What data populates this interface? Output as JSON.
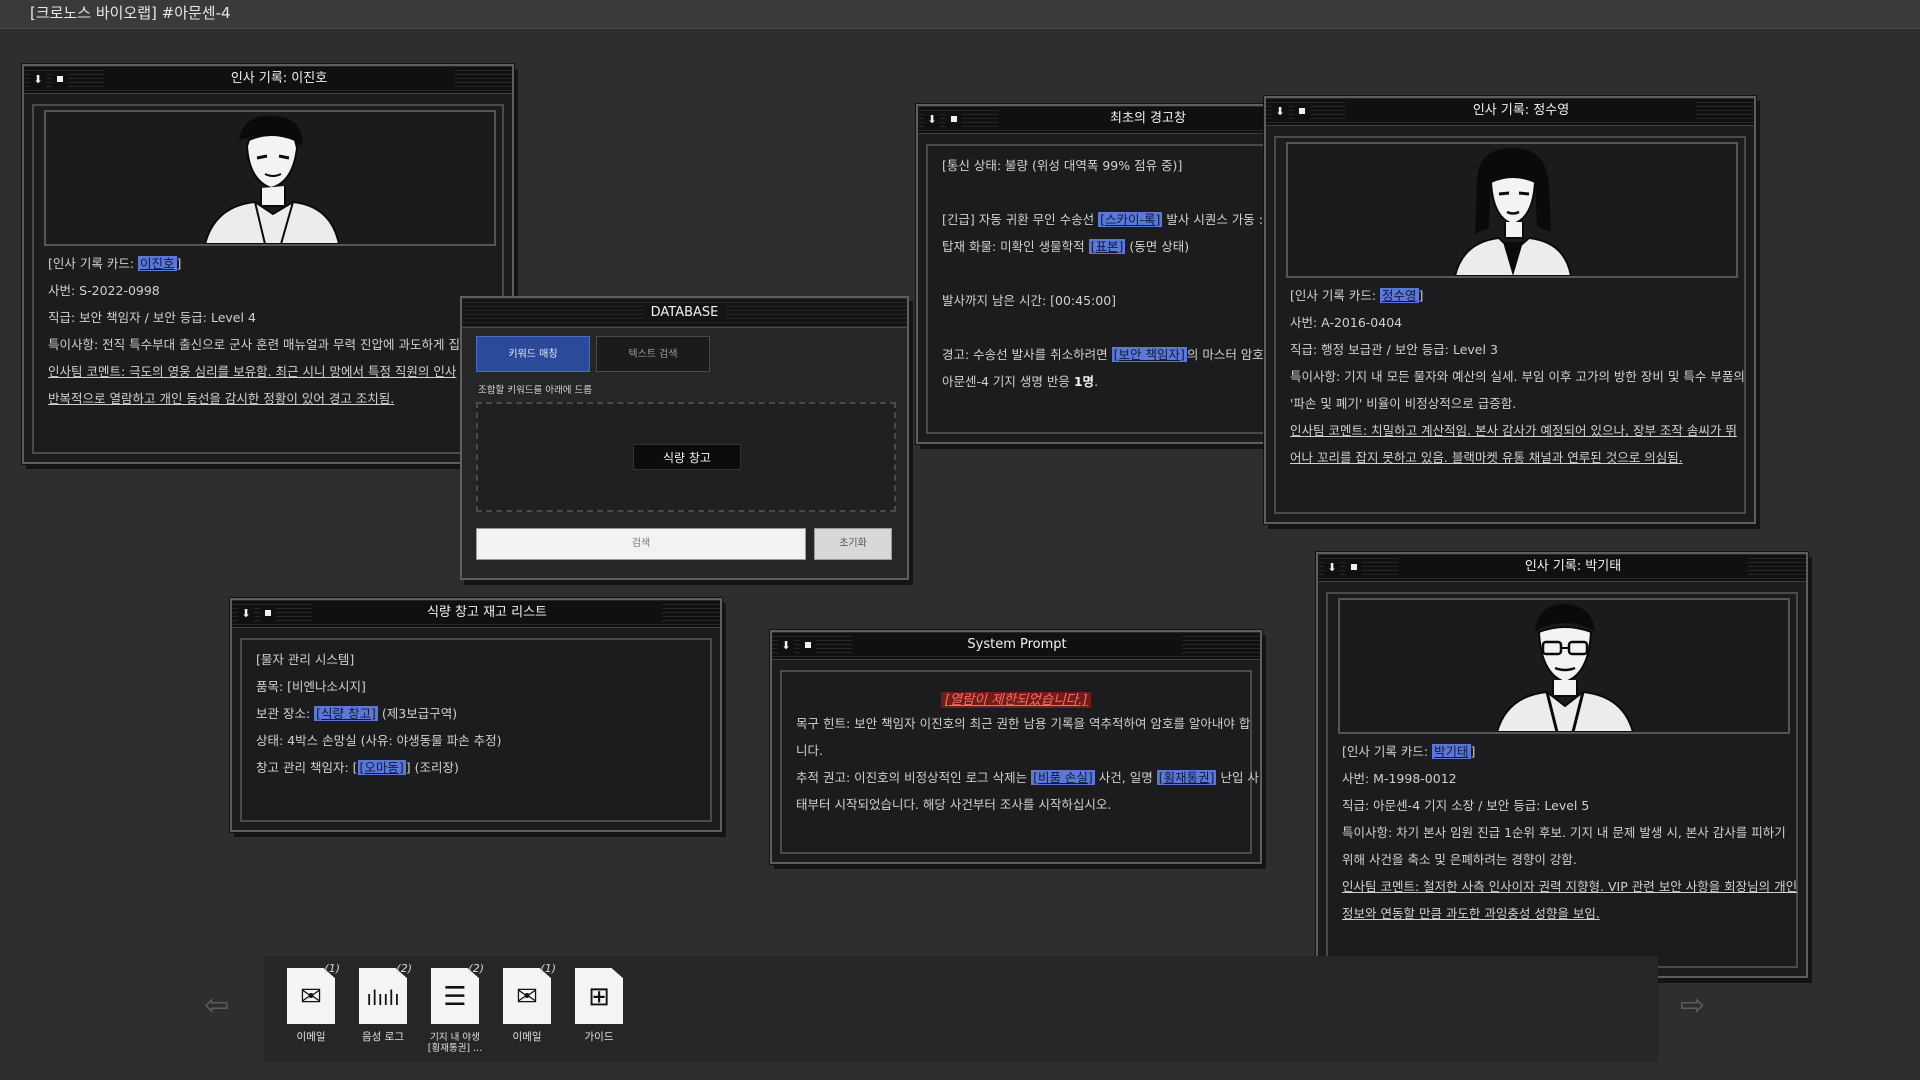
{
  "app": {
    "title": "[크로노스 바이오랩] #아문센-4"
  },
  "window_leejinho": {
    "title": "인사 기록: 이진호",
    "lines": {
      "card_prefix": "[인사 기록 카드: ",
      "card_name": "이진호",
      "card_suffix": "]",
      "id": "사번: S-2022-0998",
      "rank": "직급: 보안 책임자 / 보안 등급: Level 4",
      "note": "특이사항: 전직 특수부대 출신으로 군사 훈련 매뉴얼과 무력 진압에 과도하게 집",
      "comment1": "인사팀 코멘트: 극도의 영웅 심리를 보유함. 최근 시니 망에서 특정 직원의 인사",
      "comment2": "반복적으로 열람하고 개인 동선을 감시한 정황이 있어 경고 조치됨."
    }
  },
  "window_warning": {
    "title": "최초의 경고창",
    "lines": {
      "status": "[통신 상태: 불량 (위성 대역폭 99% 점유 중)]",
      "urgent_a": "[긴급] 자동 귀환 무인 수송선 ",
      "urgent_link": "[스카이-록]",
      "urgent_b": " 발사 시퀀스 가동 :",
      "cargo_a": "탑재 화물: 미확인 생물학적 ",
      "cargo_link": "[표본]",
      "cargo_b": " (동면 상태)",
      "time": "발사까지 남은 시간: [00:45:00]",
      "warn_a": "경고: 수송선 발사를 취소하려면 ",
      "warn_link": "[보안 책임자]",
      "warn_b": "의 마스터 암호",
      "lives_a": "아문센-4 기지 생명 반응 ",
      "lives_b": "1명",
      "lives_c": "."
    }
  },
  "window_jeongsuyoung": {
    "title": "인사 기록: 정수영",
    "lines": {
      "card_prefix": "[인사 기록 카드: ",
      "card_name": "정수영",
      "card_suffix": "]",
      "id": "사번: A-2016-0404",
      "rank": "직급: 행정 보급관 / 보안 등급: Level 3",
      "note1": "특이사항: 기지 내 모든 물자와 예산의 실세. 부임 이후 고가의 방한 장비 및 특수 부품의",
      "note2": "'파손 및 폐기' 비율이 비정상적으로 급증함.",
      "comment1": "인사팀 코멘트: 치밀하고 계산적임. 본사 감사가 예정되어 있으나, 장부 조작 솜씨가 뛰",
      "comment2": "어나 꼬리를 잡지 못하고 있음. 블랙마켓 유통 채널과 연루된 것으로 의심됨."
    }
  },
  "window_database": {
    "title": "DATABASE",
    "tab_keyword": "키워드 매칭",
    "tab_text": "텍스트 검색",
    "drop_hint": "조합할 키워드를 아래에 드롭",
    "chip": "식량 창고",
    "search_placeholder": "검색",
    "reset": "초기화"
  },
  "window_inventory": {
    "title": "식량 창고 재고 리스트",
    "lines": {
      "system": "[물자 관리 시스템]",
      "item": "품목: [비엔나소시지]",
      "loc_a": "보관 장소: ",
      "loc_link": "[식량 창고]",
      "loc_b": " (제3보급구역)",
      "state": "상태: 4박스 손망실 (사유: 야생동물 파손 추정)",
      "mgr_a": "창고 관리 책임자: [",
      "mgr_link": "[오마동]",
      "mgr_b": "] (조리장)"
    }
  },
  "window_system": {
    "title": "System Prompt",
    "alert": "[열람이 제한되었습니다.]",
    "lines": {
      "goal1": "목구 힌트: 보안 책임자 이진호의 최근 권한 남용 기록을 역추적하여 암호를 알아내야 합",
      "goal2": "니다.",
      "trace_a": "추적 권고: 이진호의 비정상적인 로그 삭제는 ",
      "trace_link1": "[비품 손실]",
      "trace_b": " 사건, 일명 ",
      "trace_link2": "[횡재통권]",
      "trace_c": " 난입 사",
      "trace2": "태부터 시작되었습니다. 해당 사건부터 조사를 시작하십시오."
    }
  },
  "window_parkgitae": {
    "title": "인사 기록: 박기태",
    "lines": {
      "card_prefix": "[인사 기록 카드: ",
      "card_name": "박기태",
      "card_suffix": "]",
      "id": "사번: M-1998-0012",
      "rank": "직급: 아문센-4 기지 소장 / 보안 등급: Level 5",
      "note1": "특이사항: 차기 본사 임원 진급 1순위 후보. 기지 내 문제 발생 시, 본사 감사를 피하기",
      "note2": "위해 사건을 축소 및 은폐하려는 경향이 강함.",
      "comment1": "인사팀 코멘트: 철저한 사측 인사이자 권력 지향형. VIP 관련 보안 사항을 회장님의 개인",
      "comment2": "정보와 연동할 만큼 과도한 과잉충성 성향을 보임."
    }
  },
  "taskbar": {
    "items": [
      {
        "label": "이메일",
        "badge": "(1)",
        "icon": "envelope-icon"
      },
      {
        "label": "음성 로그",
        "badge": "(2)",
        "icon": "waveform-icon"
      },
      {
        "label": "기지 내 야생 [횡재통권] ...",
        "badge": "(2)",
        "icon": "document-icon"
      },
      {
        "label": "이메일",
        "badge": "(1)",
        "icon": "envelope-icon"
      },
      {
        "label": "가이드",
        "badge": "",
        "icon": "network-icon"
      }
    ]
  },
  "colors": {
    "accent": "#5b78d6",
    "alert": "#ff6b5e",
    "tab_active": "#2b4a9a"
  }
}
